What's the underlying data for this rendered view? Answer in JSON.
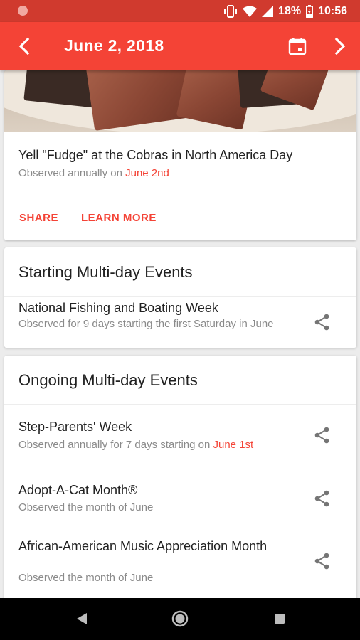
{
  "status_bar": {
    "battery": "18%",
    "time": "10:56",
    "icons": [
      "notification-dot-icon",
      "vibrate-icon",
      "wifi-icon",
      "signal-icon",
      "battery-charging-icon"
    ]
  },
  "app_bar": {
    "title": "June 2, 2018",
    "icons": [
      "back-arrow-icon",
      "calendar-icon",
      "forward-arrow-icon"
    ]
  },
  "featured": {
    "title": "Yell \"Fudge\" at the Cobras in North America Day",
    "sub_prefix": "Observed annually on ",
    "sub_date": "June 2nd",
    "actions": {
      "share": "SHARE",
      "learn_more": "LEARN MORE"
    }
  },
  "starting": {
    "heading": "Starting Multi-day Events",
    "items": [
      {
        "title": "National Fishing and Boating Week",
        "sub": "Observed for 9 days starting the first Saturday in June"
      }
    ]
  },
  "ongoing": {
    "heading": "Ongoing Multi-day Events",
    "items": [
      {
        "title": "Step-Parents' Week",
        "sub_prefix": "Observed annually for 7 days starting on ",
        "sub_date": "June 1st"
      },
      {
        "title": "Adopt-A-Cat Month®",
        "sub": "Observed the month of June"
      },
      {
        "title": "African-American Music Appreciation Month",
        "sub": "Observed the month of June"
      }
    ]
  },
  "colors": {
    "primary": "#f44336",
    "status_bar": "#d03a2e",
    "accent_text": "#f44336",
    "secondary_text": "#8a8a8a"
  },
  "nav_bar": {
    "icons": [
      "nav-back-icon",
      "nav-home-icon",
      "nav-recents-icon"
    ]
  }
}
